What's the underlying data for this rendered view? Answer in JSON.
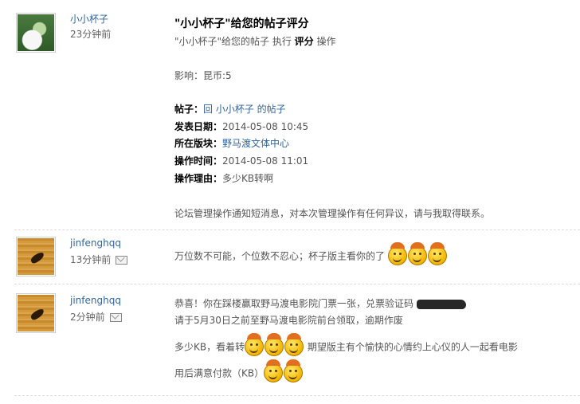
{
  "notice": {
    "user": "小小杯子",
    "time": "23分钟前",
    "title": "\"小小杯子\"给您的帖子评分",
    "subtitle_pre": "\"小小杯子\"给您的帖子 执行 ",
    "subtitle_bold": "评分",
    "subtitle_post": " 操作",
    "influence": "影响：昆币:5",
    "post_label": "帖子：",
    "post_value": "回 小小杯子 的帖子",
    "publish_label": "发表日期：",
    "publish_value": "2014-05-08 10:45",
    "board_label": "所在版块：",
    "board_value": "野马渡文体中心",
    "optime_label": "操作时间：",
    "optime_value": "2014-05-08 11:01",
    "reason_label": "操作理由：",
    "reason_value": "多少KB转啊",
    "footer": "论坛管理操作通知短消息，对本次管理操作有任何异议，请与我取得联系。"
  },
  "reply1": {
    "user": "jinfenghqq",
    "time": "13分钟前",
    "text": "万位数不可能，个位数不忍心；杯子版主看你的了",
    "emoticon_icon": "laughing-smiley-icon",
    "emoticon_count": 3
  },
  "reply2": {
    "user": "jinfenghqq",
    "time": "2分钟前",
    "line1": "恭喜！你在踩楼赢取野马渡电影院门票一张，兑票验证码",
    "line2": "请于5月30日之前至野马渡电影院前台领取，逾期作废",
    "line3_pre": "多少KB，看着转",
    "line3_post": " 期望版主有个愉快的心情约上心仪的人一起看电影",
    "line4": "用后满意付款（KB）",
    "emoticon_icon": "laughing-smiley-icon"
  }
}
